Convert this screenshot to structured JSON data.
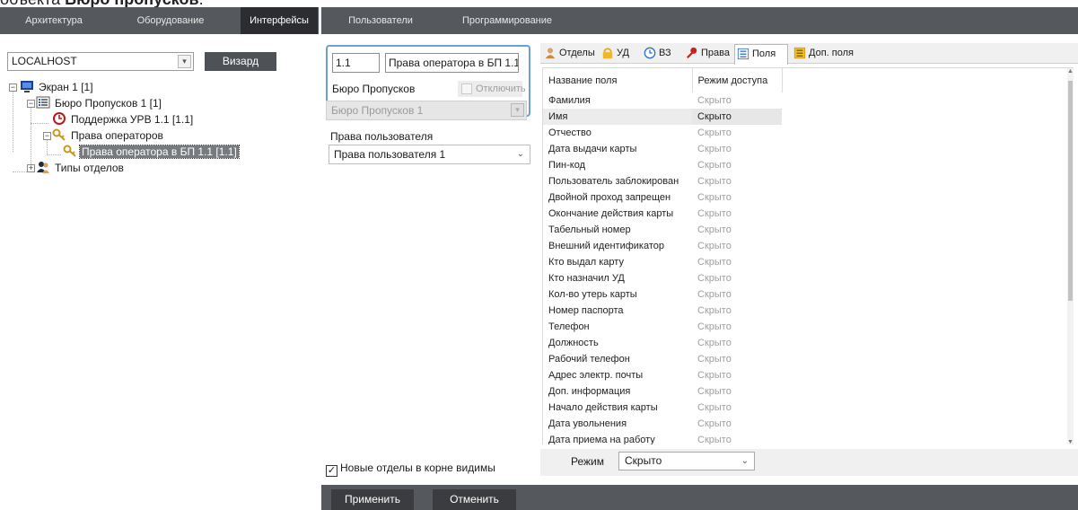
{
  "caption": {
    "prefix": "объекта ",
    "bold": "Бюро пропусков",
    "suffix": "."
  },
  "menu": {
    "tabs": [
      {
        "label": "Архитектура"
      },
      {
        "label": "Оборудование"
      },
      {
        "label": "Интерфейсы"
      },
      {
        "label": "Пользователи"
      },
      {
        "label": "Программирование"
      }
    ],
    "active": "Интерфейсы"
  },
  "left": {
    "host": "LOCALHOST",
    "wizard_label": "Визард",
    "tree": [
      {
        "label": "Экран 1 [1]",
        "icon": "monitor-icon"
      },
      {
        "label": "Бюро Пропусков 1 [1]",
        "icon": "list-icon"
      },
      {
        "label": "Поддержка УРВ 1.1 [1.1]",
        "icon": "clock-icon"
      },
      {
        "label": "Права операторов",
        "icon": "key-icon"
      },
      {
        "label": "Права оператора в БП 1.1 [1.1]",
        "icon": "key-icon"
      },
      {
        "label": "Типы отделов",
        "icon": "users-icon"
      }
    ]
  },
  "middle": {
    "number": "1.1",
    "name": "Права оператора в БП 1.1",
    "bp_label": "Бюро Пропусков",
    "disable_label": "Отключить",
    "bp_value": "Бюро Пропусков 1",
    "rights_label": "Права пользователя",
    "rights_value": "Права пользователя 1",
    "new_deps_label": "Новые отделы в корне видимы",
    "new_deps_checked": true
  },
  "right": {
    "tabs": [
      {
        "label": "Отделы",
        "icon": "person-icon"
      },
      {
        "label": "УД",
        "icon": "lock-icon"
      },
      {
        "label": "ВЗ",
        "icon": "clock-icon"
      },
      {
        "label": "Права",
        "icon": "key-icon"
      },
      {
        "label": "Поля",
        "icon": "list-icon"
      },
      {
        "label": "Доп. поля",
        "icon": "list-icon"
      }
    ],
    "active_tab": "Поля",
    "columns": {
      "field": "Название поля",
      "access": "Режим доступа"
    },
    "rows": [
      {
        "field": "Фамилия",
        "access": "Скрыто"
      },
      {
        "field": "Имя",
        "access": "Скрыто"
      },
      {
        "field": "Отчество",
        "access": "Скрыто"
      },
      {
        "field": "Дата выдачи карты",
        "access": "Скрыто"
      },
      {
        "field": "Пин-код",
        "access": "Скрыто"
      },
      {
        "field": "Пользователь заблокирован",
        "access": "Скрыто"
      },
      {
        "field": "Двойной проход запрещен",
        "access": "Скрыто"
      },
      {
        "field": "Окончание действия карты",
        "access": "Скрыто"
      },
      {
        "field": "Табельный номер",
        "access": "Скрыто"
      },
      {
        "field": "Внешний идентификатор",
        "access": "Скрыто"
      },
      {
        "field": "Кто выдал карту",
        "access": "Скрыто"
      },
      {
        "field": "Кто назначил УД",
        "access": "Скрыто"
      },
      {
        "field": "Кол-во утерь карты",
        "access": "Скрыто"
      },
      {
        "field": "Номер паспорта",
        "access": "Скрыто"
      },
      {
        "field": "Телефон",
        "access": "Скрыто"
      },
      {
        "field": "Должность",
        "access": "Скрыто"
      },
      {
        "field": "Рабочий телефон",
        "access": "Скрыто"
      },
      {
        "field": "Адрес электр. почты",
        "access": "Скрыто"
      },
      {
        "field": "Доп. информация",
        "access": "Скрыто"
      },
      {
        "field": "Начало действия карты",
        "access": "Скрыто"
      },
      {
        "field": "Дата увольнения",
        "access": "Скрыто"
      },
      {
        "field": "Дата приема на работу",
        "access": "Скрыто"
      }
    ],
    "highlighted_row": 1,
    "mode_label": "Режим",
    "mode_value": "Скрыто"
  },
  "bottom": {
    "apply_label": "Применить",
    "cancel_label": "Отменить"
  },
  "colors": {
    "menubar": "#55585c",
    "active_tab": "#2b2d30",
    "selection": "#777a7e",
    "focus_border": "#6d9fd0"
  }
}
